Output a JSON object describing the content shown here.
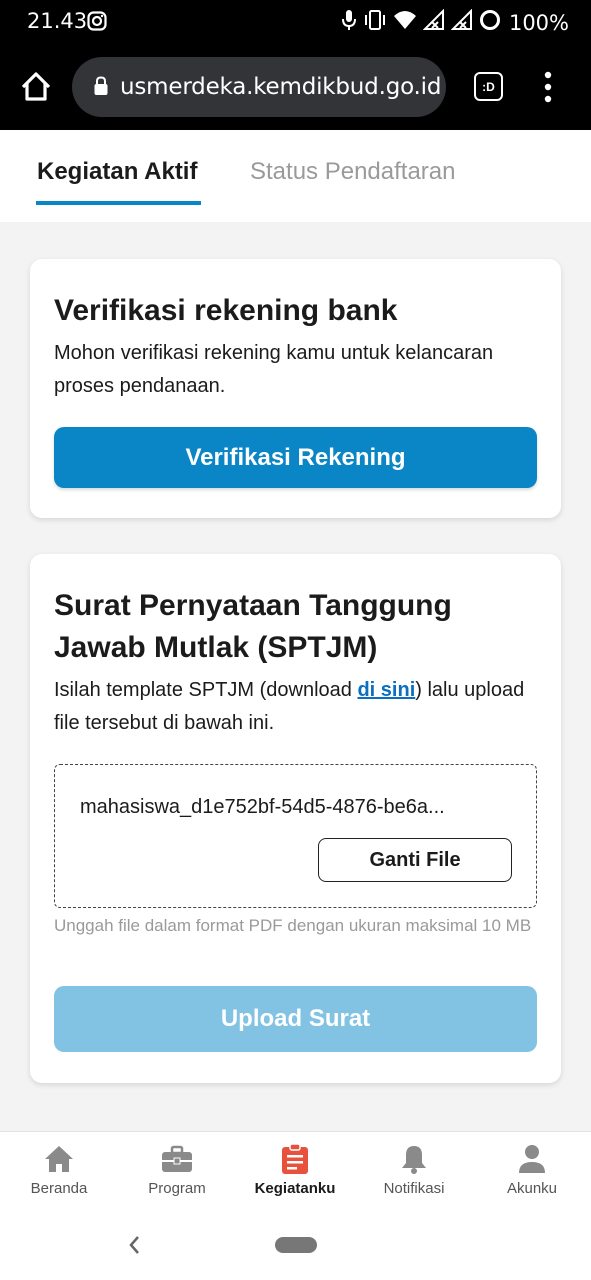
{
  "status_bar": {
    "time": "21.43",
    "battery": "100%",
    "icons": [
      "instagram-icon",
      "mic-icon",
      "vibrate-icon",
      "wifi-icon",
      "signal-icon",
      "signal-icon",
      "dnd-icon"
    ]
  },
  "browser": {
    "url": "usmerdeka.kemdikbud.go.id",
    "tab_label": ":D",
    "icons": [
      "home-icon",
      "lock-icon",
      "more-icon"
    ]
  },
  "tabs": [
    {
      "label": "Kegiatan Aktif",
      "active": true
    },
    {
      "label": "Status Pendaftaran",
      "active": false
    }
  ],
  "card_bank": {
    "title": "Verifikasi rekening bank",
    "description": "Mohon verifikasi rekening kamu untuk kelancaran proses pendanaan.",
    "button": "Verifikasi Rekening"
  },
  "card_sptjm": {
    "title": "Surat Pernyataan Tanggung Jawab Mutlak (SPTJM)",
    "desc_before": "Isilah template SPTJM (download ",
    "desc_link": "di sini",
    "desc_after": ") lalu upload file tersebut di bawah ini.",
    "filename": "mahasiswa_d1e752bf-54d5-4876-be6a...",
    "change_button": "Ganti File",
    "hint": "Unggah file dalam format PDF dengan ukuran maksimal 10 MB",
    "upload_button": "Upload Surat"
  },
  "bottom_nav": [
    {
      "label": "Beranda",
      "icon": "home-icon",
      "active": false
    },
    {
      "label": "Program",
      "icon": "briefcase-icon",
      "active": false
    },
    {
      "label": "Kegiatanku",
      "icon": "clipboard-icon",
      "active": true
    },
    {
      "label": "Notifikasi",
      "icon": "bell-icon",
      "active": false
    },
    {
      "label": "Akunku",
      "icon": "user-icon",
      "active": false
    }
  ],
  "colors": {
    "primary": "#0a86c6",
    "primary_disabled": "#82c2e3",
    "active_nav": "#e8513c",
    "link": "#0a6fc2"
  }
}
